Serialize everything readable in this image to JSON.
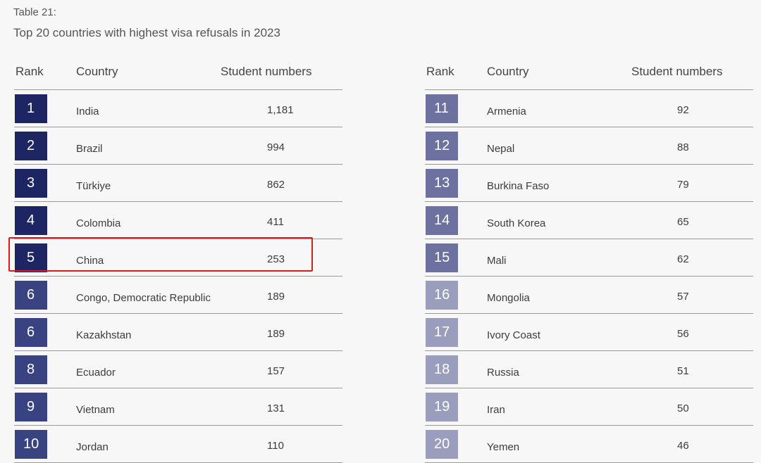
{
  "caption": "Table 21:",
  "title": "Top 20 countries with highest visa refusals in 2023",
  "headers": {
    "rank": "Rank",
    "country": "Country",
    "students": "Student numbers"
  },
  "colors": {
    "dark": "#1d2563",
    "mid": "#3a4382",
    "slate": "#6d719f",
    "light": "#9b9dbc",
    "highlight": "#d81c1c"
  },
  "left": [
    {
      "rank": "1",
      "country": "India",
      "value": "1,181",
      "shade": "dark"
    },
    {
      "rank": "2",
      "country": "Brazil",
      "value": "994",
      "shade": "dark"
    },
    {
      "rank": "3",
      "country": "Türkiye",
      "value": "862",
      "shade": "dark"
    },
    {
      "rank": "4",
      "country": "Colombia",
      "value": "411",
      "shade": "dark"
    },
    {
      "rank": "5",
      "country": "China",
      "value": "253",
      "shade": "dark"
    },
    {
      "rank": "6",
      "country": "Congo, Democratic Republic",
      "value": "189",
      "shade": "mid"
    },
    {
      "rank": "6",
      "country": "Kazakhstan",
      "value": "189",
      "shade": "mid"
    },
    {
      "rank": "8",
      "country": "Ecuador",
      "value": "157",
      "shade": "mid"
    },
    {
      "rank": "9",
      "country": "Vietnam",
      "value": "131",
      "shade": "mid"
    },
    {
      "rank": "10",
      "country": "Jordan",
      "value": "110",
      "shade": "mid"
    }
  ],
  "right": [
    {
      "rank": "11",
      "country": "Armenia",
      "value": "92",
      "shade": "slate"
    },
    {
      "rank": "12",
      "country": "Nepal",
      "value": "88",
      "shade": "slate"
    },
    {
      "rank": "13",
      "country": "Burkina Faso",
      "value": "79",
      "shade": "slate"
    },
    {
      "rank": "14",
      "country": "South Korea",
      "value": "65",
      "shade": "slate"
    },
    {
      "rank": "15",
      "country": "Mali",
      "value": "62",
      "shade": "slate"
    },
    {
      "rank": "16",
      "country": "Mongolia",
      "value": "57",
      "shade": "light"
    },
    {
      "rank": "17",
      "country": "Ivory Coast",
      "value": "56",
      "shade": "light"
    },
    {
      "rank": "18",
      "country": "Russia",
      "value": "51",
      "shade": "light"
    },
    {
      "rank": "19",
      "country": "Iran",
      "value": "50",
      "shade": "light"
    },
    {
      "rank": "20",
      "country": "Yemen",
      "value": "46",
      "shade": "light"
    }
  ]
}
